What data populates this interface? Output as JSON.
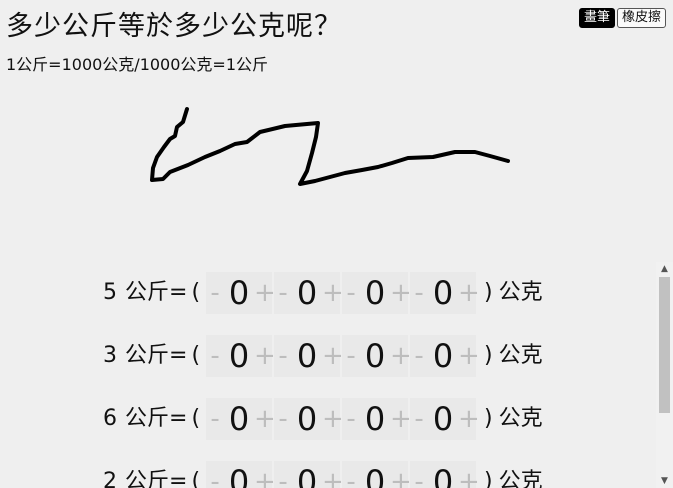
{
  "header": {
    "title": "多少公斤等於多少公克呢？",
    "subtitle": "1公斤=1000公克/1000公克=1公斤"
  },
  "tools": {
    "pen_label": "畫筆",
    "eraser_label": "橡皮擦"
  },
  "controls": {
    "minus": "-",
    "plus": "+"
  },
  "equation": {
    "unit_from": "公斤",
    "equals": "=",
    "open_paren": "(",
    "close_paren": ")",
    "unit_to": "公克"
  },
  "rows": [
    {
      "kg": "5",
      "digits": [
        "0",
        "0",
        "0",
        "0"
      ]
    },
    {
      "kg": "3",
      "digits": [
        "0",
        "0",
        "0",
        "0"
      ]
    },
    {
      "kg": "6",
      "digits": [
        "0",
        "0",
        "0",
        "0"
      ]
    },
    {
      "kg": "2",
      "digits": [
        "0",
        "0",
        "0",
        "0"
      ]
    }
  ],
  "scrollbar": {
    "up_icon": "▲",
    "down_icon": "▼"
  }
}
